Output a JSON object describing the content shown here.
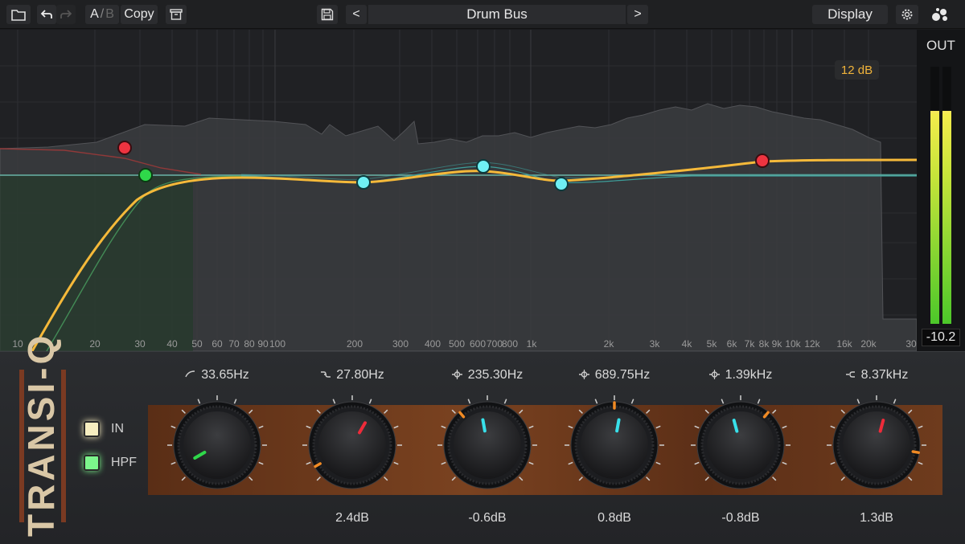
{
  "toolbar": {
    "ab_a": "A",
    "ab_sep": "/",
    "ab_b": "B",
    "copy_label": "Copy",
    "preset_name": "Drum Bus",
    "prev_label": "<",
    "next_label": ">",
    "display_label": "Display"
  },
  "graph": {
    "db_range": "12 dB",
    "freq_labels": [
      "10",
      "20",
      "30",
      "40",
      "50",
      "60",
      "70",
      "80",
      "90",
      "100",
      "200",
      "300",
      "400",
      "500",
      "600",
      "700",
      "800",
      "1k",
      "2k",
      "3k",
      "4k",
      "5k",
      "6k",
      "7k",
      "8k",
      "9k",
      "10k",
      "12k",
      "16k",
      "20k",
      "30"
    ]
  },
  "meter": {
    "title": "OUT",
    "value": "-10.2",
    "level_left": 0.82,
    "level_right": 0.82
  },
  "brand": {
    "name": "TRANSI-Q"
  },
  "switches": {
    "in_label": "IN",
    "hpf_label": "HPF"
  },
  "bands": [
    {
      "freq": "33.65Hz",
      "gain": "",
      "type": "hpf-icon",
      "color": "#2fd84a"
    },
    {
      "freq": "27.80Hz",
      "gain": "2.4dB",
      "type": "low-shelf-icon",
      "color": "#ee2b3a"
    },
    {
      "freq": "235.30Hz",
      "gain": "-0.6dB",
      "type": "bell-icon",
      "color": "#38e0ea"
    },
    {
      "freq": "689.75Hz",
      "gain": "0.8dB",
      "type": "bell-icon",
      "color": "#38e0ea"
    },
    {
      "freq": "1.39kHz",
      "gain": "-0.8dB",
      "type": "bell-icon",
      "color": "#38e0ea"
    },
    {
      "freq": "8.37kHz",
      "gain": "1.3dB",
      "type": "high-shelf-icon",
      "color": "#ee2b3a"
    }
  ],
  "colors": {
    "curve": "#f5b93a",
    "accent_orange": "#f08a24",
    "led_in": "#f7eec0",
    "led_hpf": "#7cf58c"
  }
}
